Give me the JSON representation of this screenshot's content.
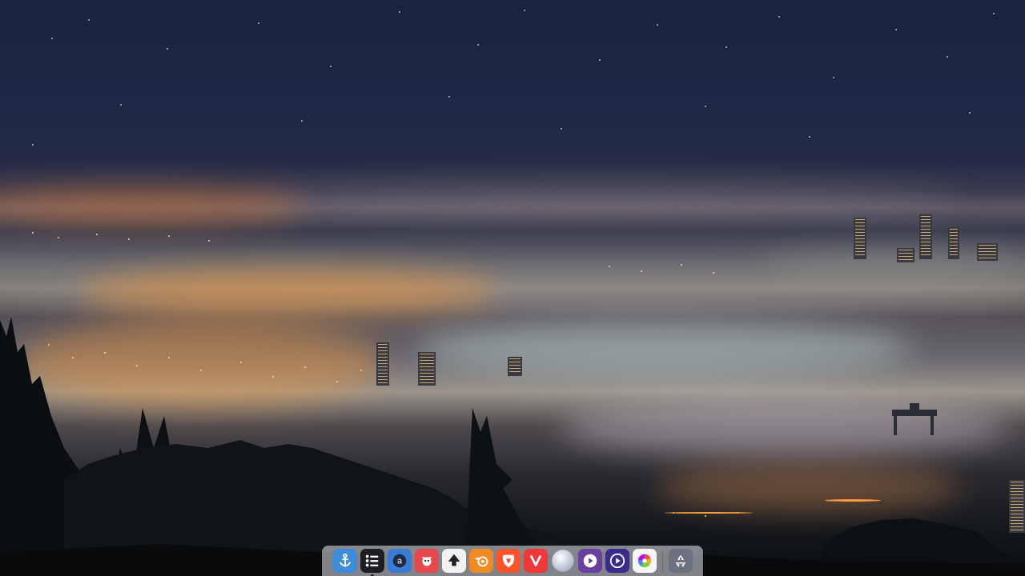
{
  "desktop": {
    "wallpaper": "foggy-city-night"
  },
  "dock": {
    "items": [
      {
        "name": "anchor-icon",
        "color": "#3d8bd9",
        "running": false
      },
      {
        "name": "task-list-icon",
        "color": "#1e1e22",
        "running": true
      },
      {
        "name": "amazon-icon",
        "color": "#3a7bd5",
        "running": false
      },
      {
        "name": "gimp-icon",
        "color": "#e5484d",
        "running": false
      },
      {
        "name": "inkscape-icon",
        "color": "#f2f2f2",
        "running": false
      },
      {
        "name": "blender-icon",
        "color": "#f08a24",
        "running": false
      },
      {
        "name": "brave-icon",
        "color": "#fb542b",
        "running": false
      },
      {
        "name": "vivaldi-icon",
        "color": "#ef3939",
        "running": false
      },
      {
        "name": "sphere-icon",
        "color": "#cfd6e6",
        "running": false
      },
      {
        "name": "media-player-icon",
        "color": "#6b3fa0",
        "running": false
      },
      {
        "name": "media-player-alt-icon",
        "color": "#3b2a8a",
        "running": false
      },
      {
        "name": "color-palette-icon",
        "color": "#f5f5f5",
        "running": false
      },
      {
        "name": "trash-icon",
        "color": "#6c7280",
        "running": false
      }
    ]
  }
}
